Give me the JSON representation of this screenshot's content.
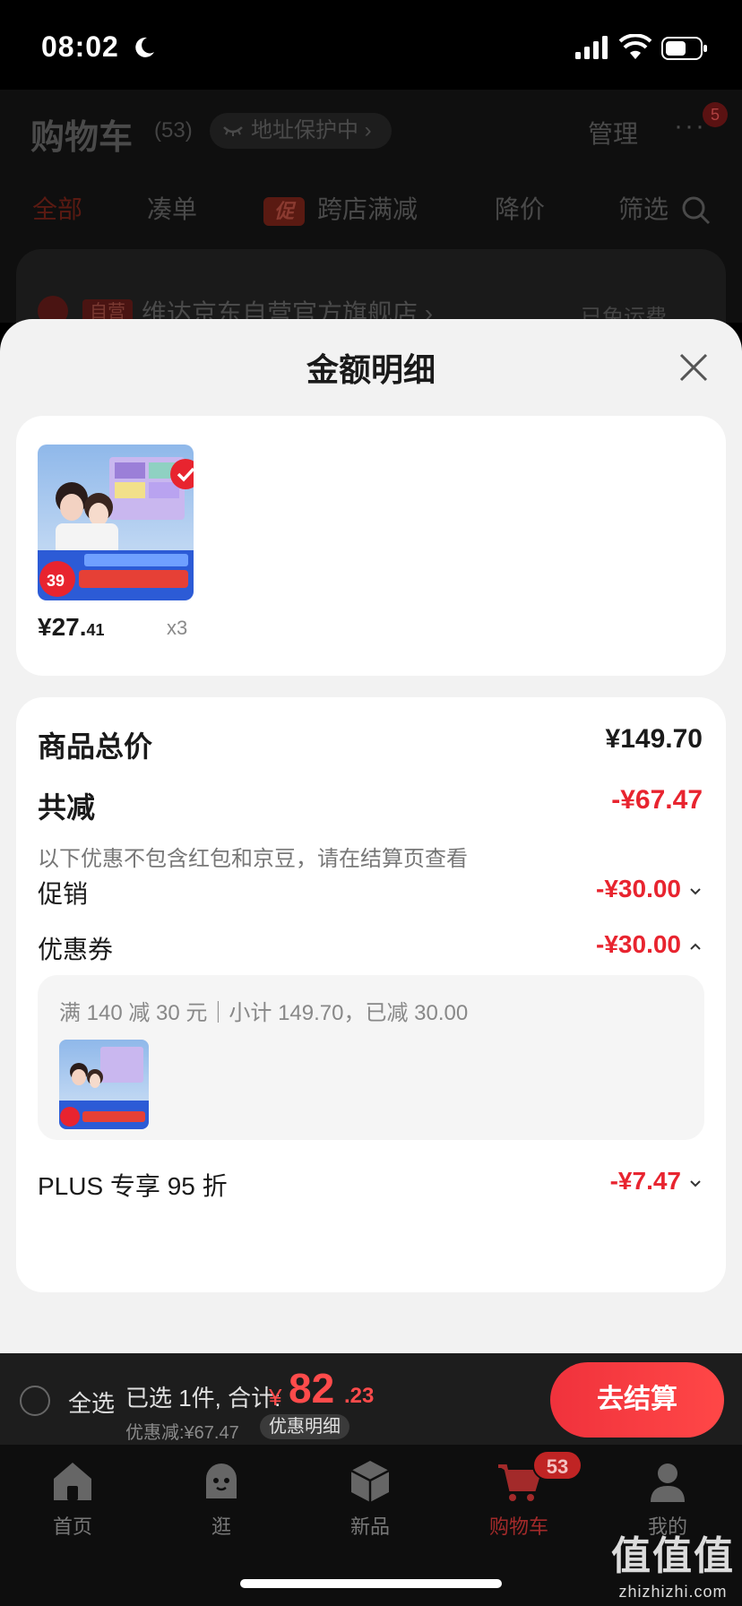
{
  "status_bar": {
    "time": "08:02"
  },
  "background": {
    "title": "购物车",
    "count": "(53)",
    "address_protect": "地址保护中 ›",
    "manage": "管理",
    "more": "···",
    "more_badge": "5",
    "tabs": [
      "全部",
      "凑单",
      "跨店满减",
      "降价",
      "筛选"
    ],
    "promo_tag": "促",
    "store": {
      "tag": "自营",
      "name": "维达京东自营官方旗舰店 ›",
      "shipping": "已免运费"
    }
  },
  "sheet": {
    "title": "金额明细",
    "item": {
      "price_int": "¥27.",
      "price_dec": "41",
      "quantity": "x3"
    },
    "summary": {
      "total_label": "商品总价",
      "total_value": "¥149.70",
      "reduce_label": "共减",
      "reduce_value": "-¥67.47",
      "note": "以下优惠不包含红包和京豆，请在结算页查看",
      "promo_label": "促销",
      "promo_value": "-¥30.00",
      "coupon_label": "优惠券",
      "coupon_value": "-¥30.00",
      "coupon_detail": "满 140 减 30 元｜小计 149.70，已减 30.00",
      "plus_label": "PLUS 专享 95 折",
      "plus_value": "-¥7.47"
    }
  },
  "checkout_bar": {
    "select_all": "全选",
    "selected": "已选 1件, 合计:",
    "total_symbol": "¥",
    "total_int": "82",
    "total_dec": ".23",
    "discount": "优惠减:¥67.47",
    "detail_chip": "优惠明细",
    "checkout_button": "去结算"
  },
  "tabbar": {
    "items": [
      {
        "label": "首页",
        "icon": "home-icon"
      },
      {
        "label": "逛",
        "icon": "explore-icon"
      },
      {
        "label": "新品",
        "icon": "cube-icon"
      },
      {
        "label": "购物车",
        "icon": "cart-icon",
        "badge": "53",
        "active": true
      },
      {
        "label": "我的",
        "icon": "user-icon"
      }
    ]
  },
  "watermark": {
    "main": "值值值",
    "sub": "zhizhizhi.com"
  },
  "colors": {
    "accent": "#e8242f",
    "sheet_bg": "#f2f2f2",
    "card_bg": "#ffffff"
  }
}
